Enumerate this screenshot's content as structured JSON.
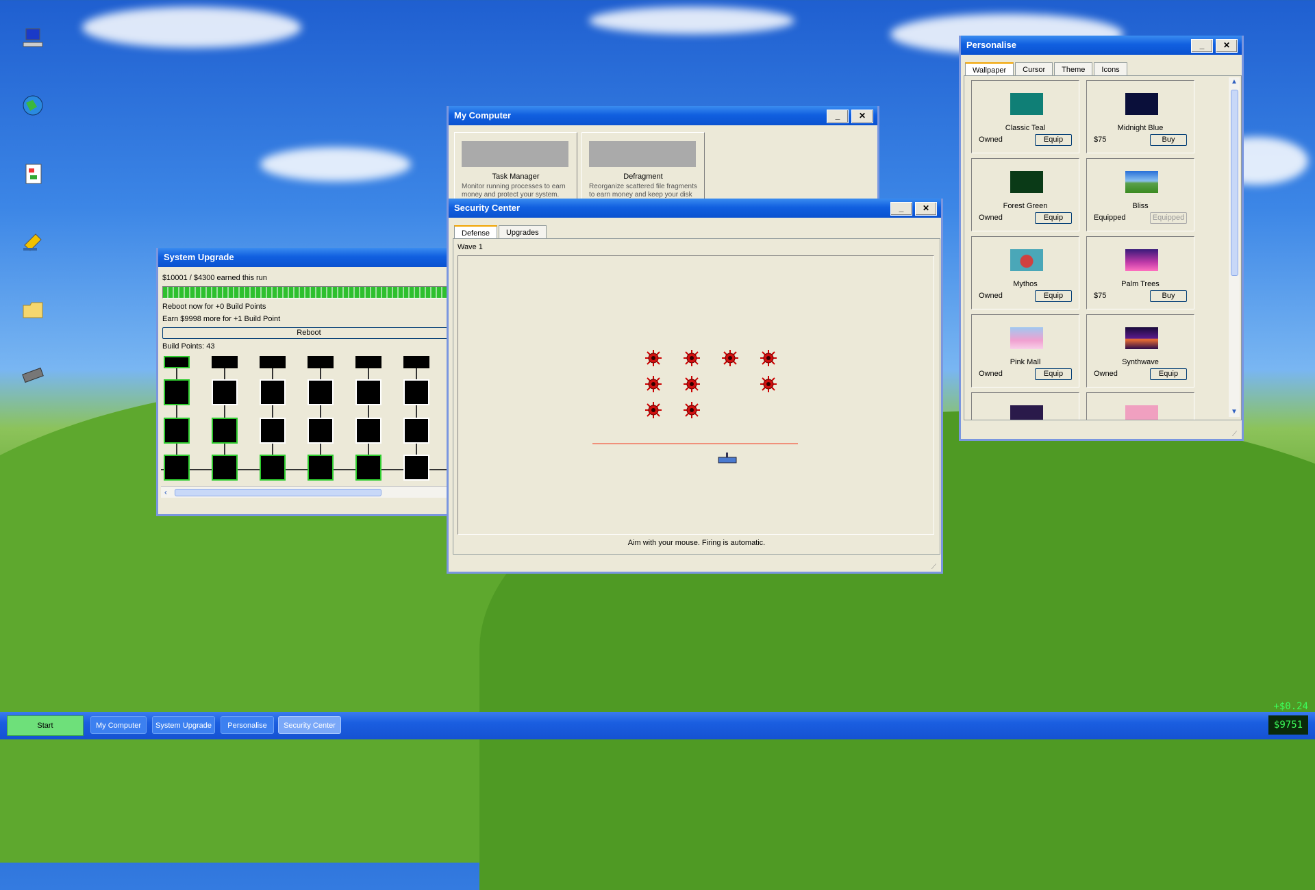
{
  "desktop": {
    "icons": [
      "computer-icon",
      "globe-icon",
      "task-icon",
      "cleaner-icon",
      "folder-icon",
      "chip-icon"
    ]
  },
  "my_computer": {
    "title": "My Computer",
    "apps": [
      {
        "name": "Task Manager",
        "desc": "Monitor running processes to earn money and protect your system."
      },
      {
        "name": "Defragment",
        "desc": "Reorganize scattered file fragments to earn money and keep your disk"
      }
    ]
  },
  "system_upgrade": {
    "title": "System Upgrade",
    "earned": "$10001 / $4300 earned this run",
    "progress": 1.0,
    "reboot_now": "Reboot now for +0 Build Points",
    "earn_more": "Earn $9998 more for +1 Build Point",
    "reboot_label": "Reboot",
    "build_points": "Build Points: 43"
  },
  "security_center": {
    "title": "Security Center",
    "tabs": [
      "Defense",
      "Upgrades"
    ],
    "active_tab": "Defense",
    "wave": "Wave 1",
    "hint": "Aim with your mouse. Firing is automatic."
  },
  "personalise": {
    "title": "Personalise",
    "tabs": [
      "Wallpaper",
      "Cursor",
      "Theme",
      "Icons"
    ],
    "active_tab": "Wallpaper",
    "items": [
      {
        "name": "Classic Teal",
        "status": "Owned",
        "action": "Equip",
        "color": "#0f7f76"
      },
      {
        "name": "Midnight Blue",
        "status": "$75",
        "action": "Buy",
        "color": "#0a0f3a"
      },
      {
        "name": "Forest Green",
        "status": "Owned",
        "action": "Equip",
        "color": "#0a3a17"
      },
      {
        "name": "Bliss",
        "status": "Equipped",
        "action": "Equipped",
        "color": "#5aa04a"
      },
      {
        "name": "Mythos",
        "status": "Owned",
        "action": "Equip",
        "color": "#4aa7b8"
      },
      {
        "name": "Palm Trees",
        "status": "$75",
        "action": "Buy",
        "color": "#c03aa8"
      },
      {
        "name": "Pink Mall",
        "status": "Owned",
        "action": "Equip",
        "color": "#f0a0d0"
      },
      {
        "name": "Synthwave",
        "status": "Owned",
        "action": "Equip",
        "color": "#5a1a8a"
      }
    ]
  },
  "taskbar": {
    "start": "Start",
    "items": [
      "My Computer",
      "System Upgrade",
      "Personalise",
      "Security Center"
    ],
    "active": "Security Center",
    "income": "+$0.24",
    "money": "$9751"
  }
}
